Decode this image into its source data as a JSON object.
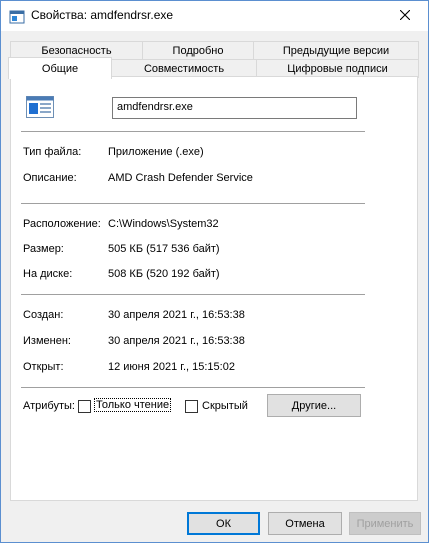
{
  "window": {
    "title": "Свойства: amdfendrsr.exe"
  },
  "tabs_row1": [
    {
      "label": "Безопасность"
    },
    {
      "label": "Подробно"
    },
    {
      "label": "Предыдущие версии"
    }
  ],
  "tabs_row2": [
    {
      "label": "Общие",
      "active": true
    },
    {
      "label": "Совместимость"
    },
    {
      "label": "Цифровые подписи"
    }
  ],
  "general": {
    "file_name": "amdfendrsr.exe",
    "file_type_label": "Тип файла:",
    "file_type_value": "Приложение (.exe)",
    "description_label": "Описание:",
    "description_value": "AMD Crash Defender Service",
    "location_label": "Расположение:",
    "location_value": "C:\\Windows\\System32",
    "size_label": "Размер:",
    "size_value": "505 КБ (517 536 байт)",
    "disk_size_label": "На диске:",
    "disk_size_value": "508 КБ (520 192 байт)",
    "created_label": "Создан:",
    "created_value": "30 апреля 2021 г., 16:53:38",
    "modified_label": "Изменен:",
    "modified_value": "30 апреля 2021 г., 16:53:38",
    "accessed_label": "Открыт:",
    "accessed_value": "12 июня 2021 г., 15:15:02",
    "attributes_label": "Атрибуты:",
    "readonly_label": "Только чтение",
    "readonly_checked": false,
    "hidden_label": "Скрытый",
    "hidden_checked": false,
    "other_button": "Другие..."
  },
  "footer": {
    "ok": "ОК",
    "cancel": "Отмена",
    "apply": "Применить"
  }
}
